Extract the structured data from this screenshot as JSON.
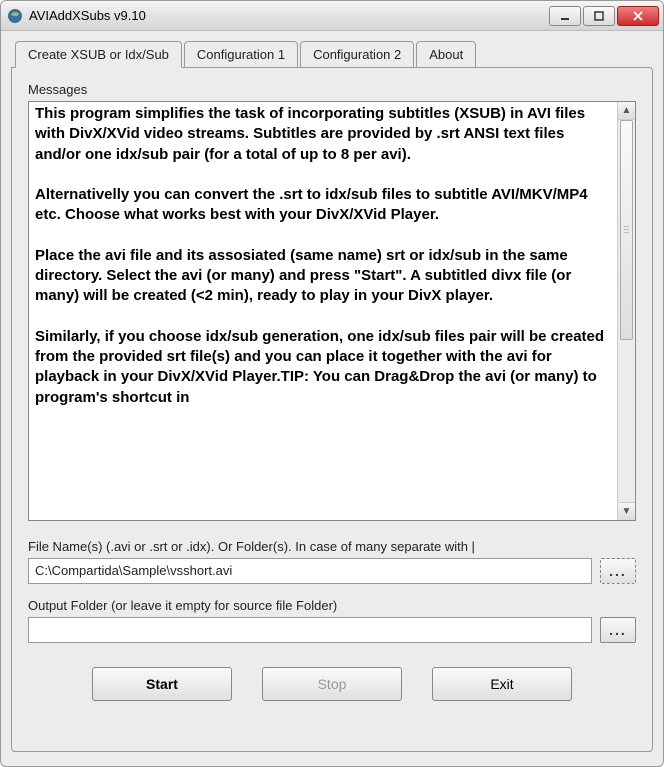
{
  "window": {
    "title": "AVIAddXSubs v9.10"
  },
  "tabs": [
    {
      "label": "Create XSUB or Idx/Sub"
    },
    {
      "label": "Configuration 1"
    },
    {
      "label": "Configuration 2"
    },
    {
      "label": "About"
    }
  ],
  "messages": {
    "label": "Messages",
    "text": "This program simplifies the task of incorporating subtitles (XSUB) in AVI files with DivX/XVid video streams. Subtitles are provided by .srt ANSI text files and/or one idx/sub pair (for a total of up to 8 per avi).\n\nAlternativelly you can convert the .srt to idx/sub files to subtitle AVI/MKV/MP4 etc. Choose what works best with your DivX/XVid Player.\n\nPlace the avi file and its assosiated (same name) srt or idx/sub in the same directory. Select the avi (or many) and press \"Start\". A subtitled divx file (or many) will be created (<2 min), ready to play in your DivX player.\n\nSimilarly, if you choose idx/sub generation, one idx/sub files pair will be created from the provided srt file(s) and you can place it together with the avi for playback in your DivX/XVid Player.TIP: You can Drag&Drop the avi (or many) to program's shortcut in"
  },
  "filename": {
    "label": "File Name(s) (.avi or .srt or .idx). Or Folder(s). In case of many separate with |",
    "value": "C:\\Compartida\\Sample\\vsshort.avi"
  },
  "output": {
    "label": "Output Folder (or leave it empty for source file Folder)",
    "value": ""
  },
  "buttons": {
    "start": "Start",
    "stop": "Stop",
    "exit": "Exit",
    "browse": "..."
  }
}
